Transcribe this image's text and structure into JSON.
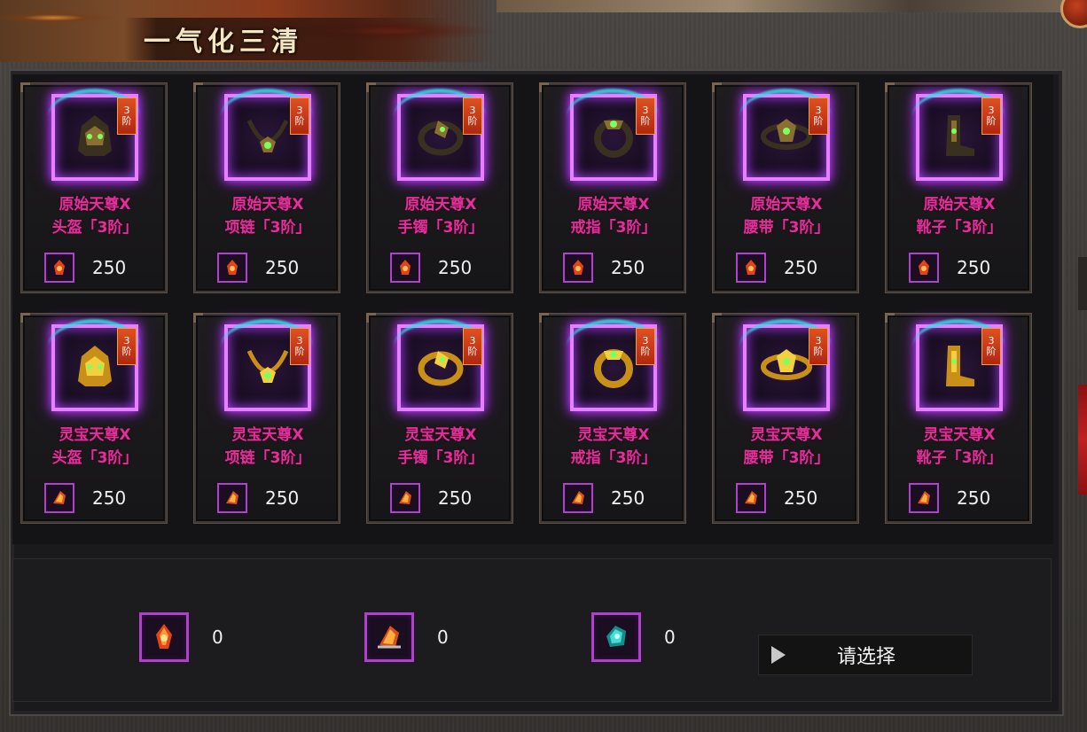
{
  "title": "一气化三清",
  "items": [
    {
      "name": "原始天尊X\n头盔「3阶」",
      "tier": "3阶",
      "cost": "250",
      "icon": "helmet-icon",
      "set": "yuanshi"
    },
    {
      "name": "原始天尊X\n项链「3阶」",
      "tier": "3阶",
      "cost": "250",
      "icon": "necklace-icon",
      "set": "yuanshi"
    },
    {
      "name": "原始天尊X\n手镯「3阶」",
      "tier": "3阶",
      "cost": "250",
      "icon": "bracelet-icon",
      "set": "yuanshi"
    },
    {
      "name": "原始天尊X\n戒指「3阶」",
      "tier": "3阶",
      "cost": "250",
      "icon": "ring-icon",
      "set": "yuanshi"
    },
    {
      "name": "原始天尊X\n腰带「3阶」",
      "tier": "3阶",
      "cost": "250",
      "icon": "belt-icon",
      "set": "yuanshi"
    },
    {
      "name": "原始天尊X\n靴子「3阶」",
      "tier": "3阶",
      "cost": "250",
      "icon": "boots-icon",
      "set": "yuanshi"
    },
    {
      "name": "灵宝天尊X\n头盔「3阶」",
      "tier": "3阶",
      "cost": "250",
      "icon": "helmet-icon",
      "set": "lingbao"
    },
    {
      "name": "灵宝天尊X\n项链「3阶」",
      "tier": "3阶",
      "cost": "250",
      "icon": "necklace-icon",
      "set": "lingbao"
    },
    {
      "name": "灵宝天尊X\n手镯「3阶」",
      "tier": "3阶",
      "cost": "250",
      "icon": "bracelet-icon",
      "set": "lingbao"
    },
    {
      "name": "灵宝天尊X\n戒指「3阶」",
      "tier": "3阶",
      "cost": "250",
      "icon": "ring-icon",
      "set": "lingbao"
    },
    {
      "name": "灵宝天尊X\n腰带「3阶」",
      "tier": "3阶",
      "cost": "250",
      "icon": "belt-icon",
      "set": "lingbao"
    },
    {
      "name": "灵宝天尊X\n靴子「3阶」",
      "tier": "3阶",
      "cost": "250",
      "icon": "boots-icon",
      "set": "lingbao"
    }
  ],
  "resources": [
    {
      "icon": "red-crystal-icon",
      "count": "0"
    },
    {
      "icon": "orange-crystal-icon",
      "count": "0"
    },
    {
      "icon": "cyan-crystal-icon",
      "count": "0"
    }
  ],
  "select_label": "请选择",
  "colors": {
    "item_name": "#e0309a",
    "frame_glow": "#c040ff",
    "arc_glow": "#30e0e0"
  }
}
